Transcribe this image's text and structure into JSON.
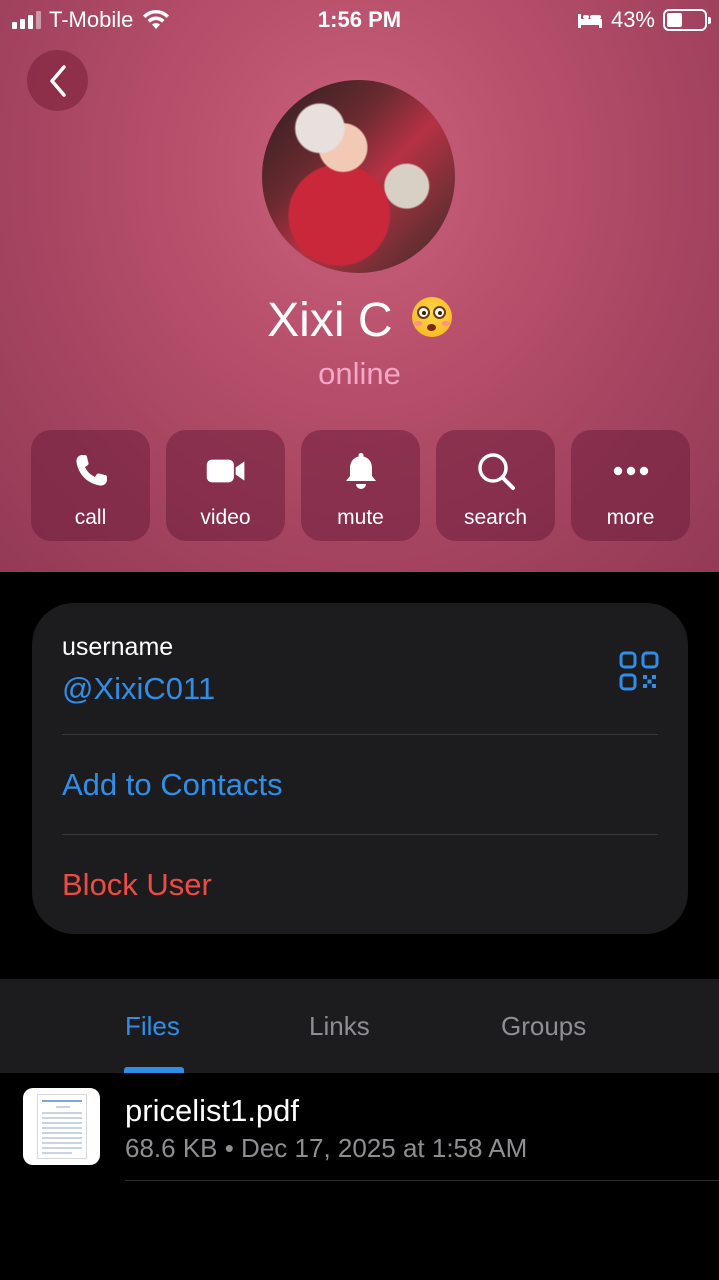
{
  "status_bar": {
    "carrier": "T-Mobile",
    "time": "1:56 PM",
    "battery": "43%",
    "battery_level": 0.43
  },
  "profile": {
    "name": "Xixi C",
    "presence": "online"
  },
  "actions": [
    {
      "label": "call",
      "icon": "phone-icon"
    },
    {
      "label": "video",
      "icon": "video-camera-icon"
    },
    {
      "label": "mute",
      "icon": "bell-icon"
    },
    {
      "label": "search",
      "icon": "magnifier-icon"
    },
    {
      "label": "more",
      "icon": "ellipsis-icon"
    }
  ],
  "info": {
    "username_label": "username",
    "username_value": "@XixiC011",
    "add_contacts": "Add to Contacts",
    "block_user": "Block User"
  },
  "tabs": [
    {
      "label": "Files",
      "active": true
    },
    {
      "label": "Links",
      "active": false
    },
    {
      "label": "Groups",
      "active": false
    }
  ],
  "files": [
    {
      "name": "pricelist1.pdf",
      "meta": "68.6 KB • Dec 17, 2025 at 1:58 AM"
    }
  ],
  "colors": {
    "accent_blue": "#2f8ee8",
    "danger_red": "#ee4b43",
    "header_pink": "#b8506c",
    "presence_pink": "#f6a6c6",
    "card_bg": "#1c1c1e"
  }
}
